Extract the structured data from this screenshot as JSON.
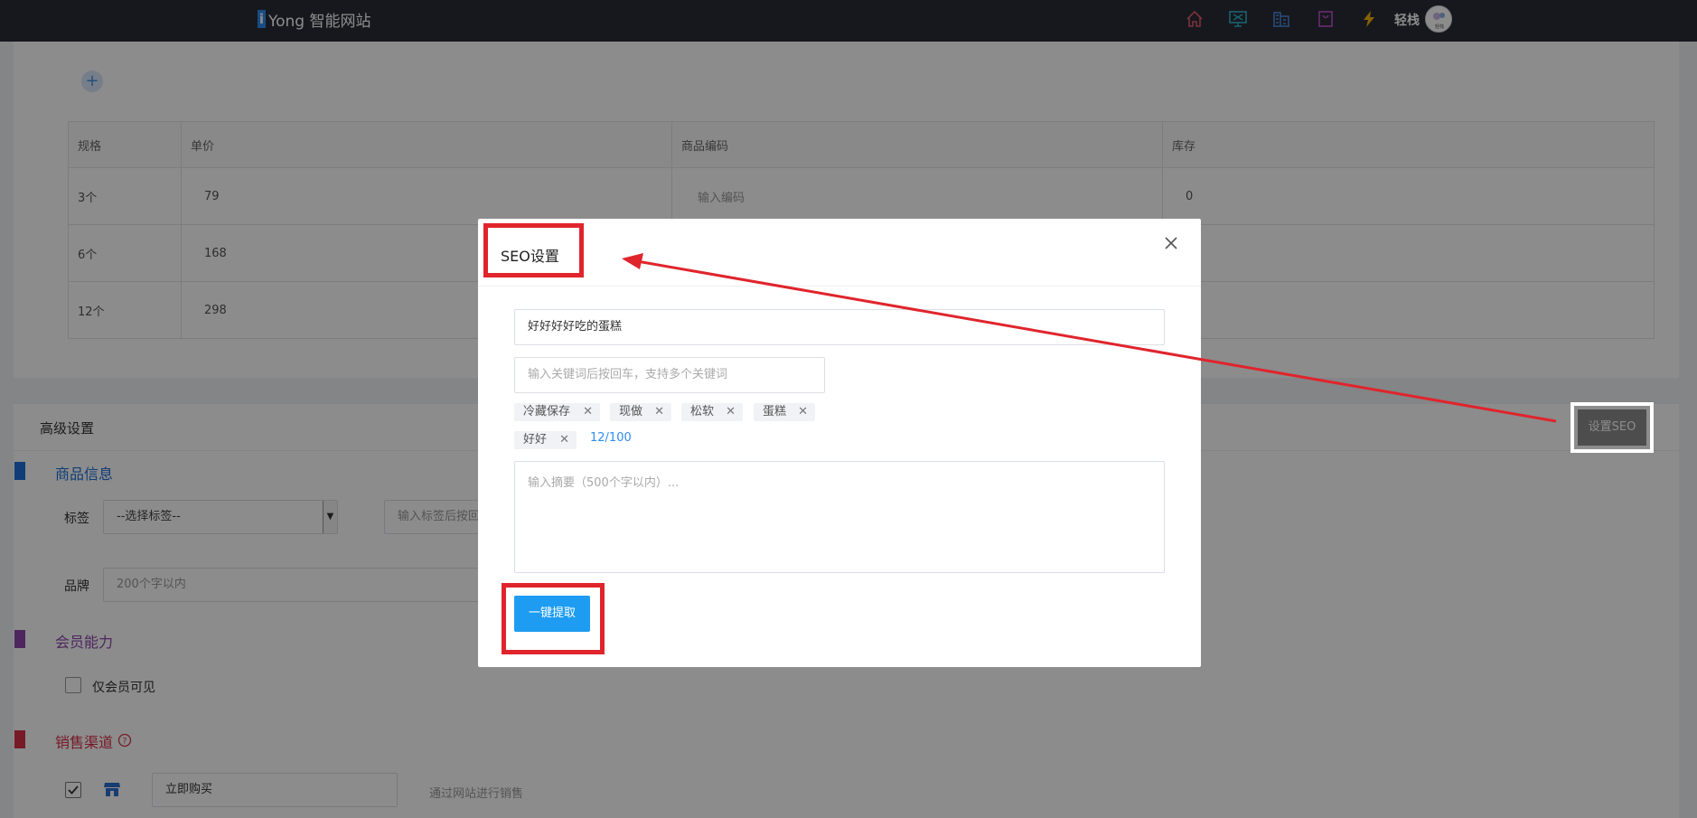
{
  "header": {
    "logo_mark": "i",
    "logo_text": "Yong 智能网站",
    "username": "轻栈",
    "avatar_text": "轻栈",
    "icons": [
      "home-icon",
      "monitor-icon",
      "building-icon",
      "bag-icon",
      "lightning-icon"
    ]
  },
  "spec_table": {
    "headers": [
      "规格",
      "单价",
      "商品编码",
      "库存"
    ],
    "rows": [
      {
        "spec": "3个",
        "price": "79",
        "code": "输入编码",
        "stock": "0"
      },
      {
        "spec": "6个",
        "price": "168",
        "code": "",
        "stock": ""
      },
      {
        "spec": "12个",
        "price": "298",
        "code": "",
        "stock": ""
      }
    ]
  },
  "advanced": {
    "title": "高级设置",
    "seo_button": "设置SEO",
    "product_info": {
      "title": "商品信息",
      "tag_label": "标签",
      "tag_select": "--选择标签--",
      "tag_input_placeholder": "输入标签后按回",
      "brand_label": "品牌",
      "brand_placeholder": "200个字以内"
    },
    "member": {
      "title": "会员能力",
      "members_only": "仅会员可见"
    },
    "sales": {
      "title": "销售渠道",
      "buy_now": "立即购买",
      "website_sale": "通过网站进行销售"
    }
  },
  "colors": {
    "accent": "#1e9cf2",
    "annotation_red": "#e0242c",
    "section_blue": "#1e6fd9",
    "section_purple": "#8e44ad",
    "section_red": "#d9304a"
  },
  "modal": {
    "title": "SEO设置",
    "seo_title_value": "好好好好吃的蛋糕",
    "keyword_placeholder": "输入关键词后按回车，支持多个关键词",
    "tags": [
      "冷藏保存",
      "现做",
      "松软",
      "蛋糕",
      "好好"
    ],
    "counter": "12/100",
    "summary_placeholder": "输入摘要（500个字以内）...",
    "extract_button": "一键提取"
  }
}
